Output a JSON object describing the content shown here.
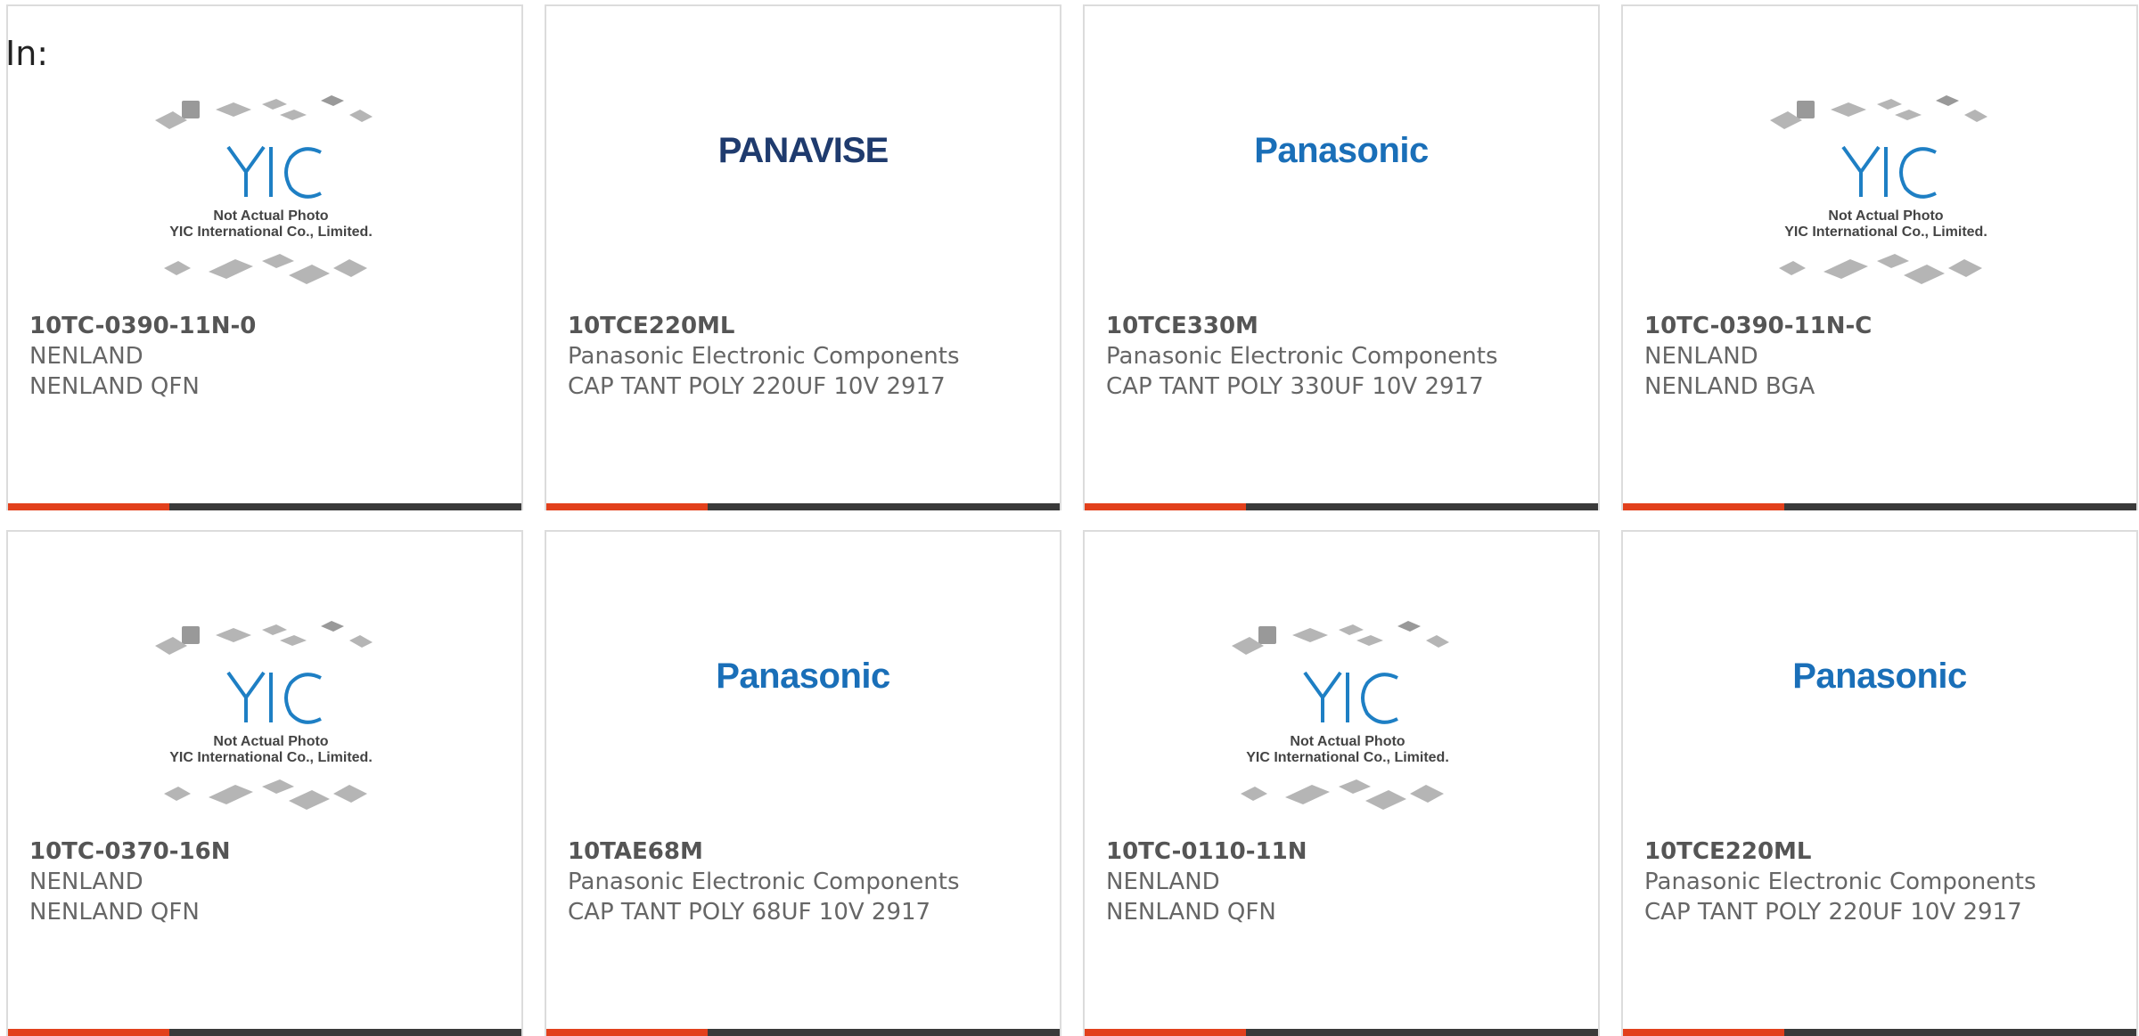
{
  "header": {
    "label": "In:"
  },
  "placeholder": {
    "line1": "Not Actual Photo",
    "line2": "YIC International Co., Limited.",
    "logo_text": "YIC"
  },
  "accent_color": "#e2401c",
  "bar_color": "#3a3a3a",
  "products": [
    {
      "part": "10TC-0390-11N-0",
      "maker": "NENLAND",
      "desc": "NENLAND QFN",
      "image": "yic-placeholder"
    },
    {
      "part": "10TCE220ML",
      "maker": "Panasonic Electronic Components",
      "desc": "CAP TANT POLY 220UF 10V 2917",
      "image": "panavise-logo",
      "logo": "PANAVISE"
    },
    {
      "part": "10TCE330M",
      "maker": "Panasonic Electronic Components",
      "desc": "CAP TANT POLY 330UF 10V 2917",
      "image": "panasonic-logo",
      "logo": "Panasonic"
    },
    {
      "part": "10TC-0390-11N-C",
      "maker": "NENLAND",
      "desc": "NENLAND BGA",
      "image": "yic-placeholder"
    },
    {
      "part": "10TC-0370-16N",
      "maker": "NENLAND",
      "desc": "NENLAND QFN",
      "image": "yic-placeholder"
    },
    {
      "part": "10TAE68M",
      "maker": "Panasonic Electronic Components",
      "desc": "CAP TANT POLY 68UF 10V 2917",
      "image": "panasonic-logo",
      "logo": "Panasonic"
    },
    {
      "part": "10TC-0110-11N",
      "maker": "NENLAND",
      "desc": "NENLAND QFN",
      "image": "yic-placeholder"
    },
    {
      "part": "10TCE220ML",
      "maker": "Panasonic Electronic Components",
      "desc": "CAP TANT POLY 220UF 10V 2917",
      "image": "panasonic-logo",
      "logo": "Panasonic"
    }
  ]
}
